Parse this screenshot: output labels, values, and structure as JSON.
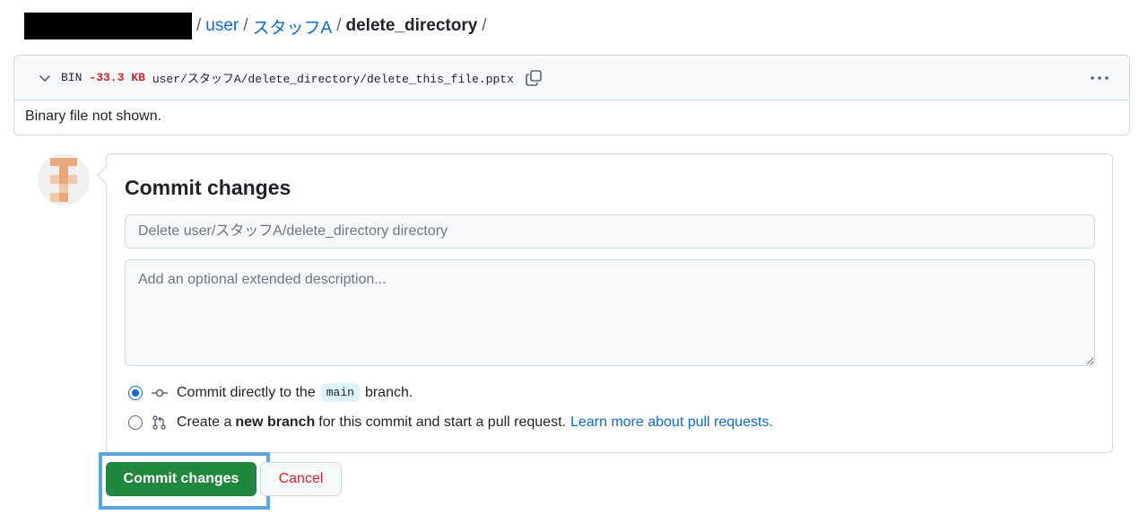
{
  "breadcrumb": {
    "sep1": "/",
    "user": "user",
    "sep2": "/",
    "folder": "スタッフA",
    "sep3": "/",
    "current": "delete_directory",
    "sep4": "/"
  },
  "diff": {
    "type": "BIN",
    "size": "-33.3 KB",
    "path": "user/スタッフA/delete_directory/delete_this_file.pptx",
    "body": "Binary file not shown."
  },
  "commit": {
    "title": "Commit changes",
    "summary_placeholder": "Delete user/スタッフA/delete_directory directory",
    "description_placeholder": "Add an optional extended description...",
    "option_direct": {
      "prefix": "Commit directly to the",
      "branch": "main",
      "suffix": "branch."
    },
    "option_new": {
      "prefix": "Create a",
      "bold": "new branch",
      "suffix": "for this commit and start a pull request.",
      "link": "Learn more about pull requests."
    },
    "commit_button": "Commit changes",
    "cancel_button": "Cancel"
  },
  "colors": {
    "link": "#0969da",
    "deletion": "#d1242f",
    "primary_button": "#1f883d",
    "highlight": "#5aa7e0"
  },
  "icons": [
    "chevron-down-icon",
    "copy-icon",
    "kebab-horizontal-icon",
    "git-commit-icon",
    "git-pull-request-icon"
  ]
}
